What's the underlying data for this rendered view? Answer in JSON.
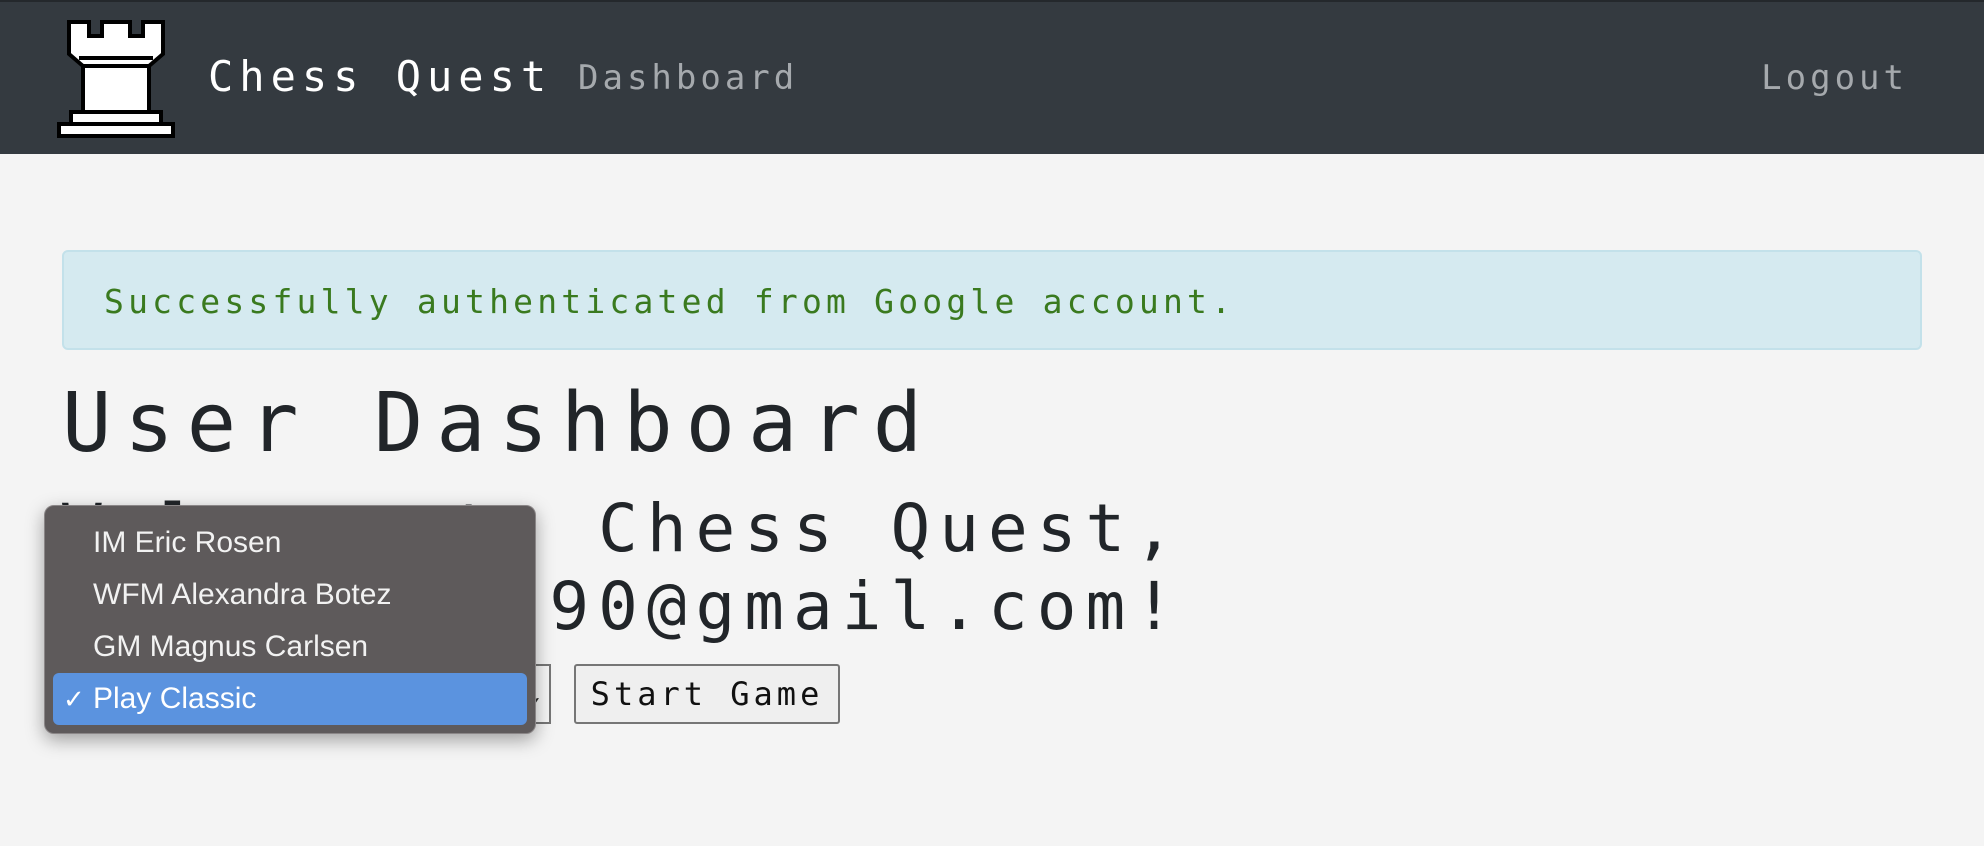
{
  "navbar": {
    "brand": "Chess Quest",
    "links": {
      "dashboard": "Dashboard",
      "logout": "Logout"
    },
    "logo_icon": "rook-icon",
    "bg_color": "#343a40"
  },
  "alert": {
    "message": "Successfully authenticated from Google account.",
    "text_color": "#3a7a1f",
    "bg_color": "#d5eaf0"
  },
  "page": {
    "title": "User Dashboard",
    "welcome_line1": "Welcome to Chess Quest,",
    "welcome_line2": "bejoysmith90@gmail.com!"
  },
  "game_select": {
    "selected": "Play Classic",
    "options": [
      "IM Eric Rosen",
      "WFM Alexandra Botez",
      "GM Magnus Carlsen",
      "Play Classic"
    ],
    "check_glyph": "✓",
    "highlight_color": "#5b93df"
  },
  "start_button": {
    "label": "Start Game"
  }
}
